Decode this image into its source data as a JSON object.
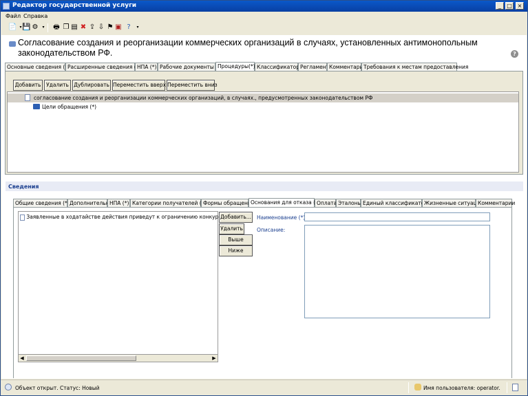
{
  "window": {
    "title": "Редактор государственной услуги",
    "controls": {
      "minimize": "_",
      "maximize": "□",
      "close": "×"
    }
  },
  "menu": {
    "items": [
      "Файл",
      "Справка"
    ]
  },
  "toolbar": {
    "icons": [
      "new-document-icon",
      "save-icon",
      "settings-icon",
      "print-icon",
      "copy-icon",
      "delete-icon",
      "export-icon",
      "import-icon",
      "pdf-icon",
      "help-icon"
    ]
  },
  "header": {
    "title": "Согласование создания и реорганизации коммерческих организаций в случаях, установленных антимонопольным законодательством РФ.",
    "help_glyph": "?"
  },
  "main_tabs": {
    "items": [
      "Основные сведения (*)",
      "Расширенные сведения (*)",
      "НПА (*)",
      "Рабочие документы (*)",
      "Процедуры(*)",
      "Классификаторы",
      "Регламент",
      "Комментарии",
      "Требования к местам предоставления"
    ],
    "active_index": 4
  },
  "procedures": {
    "buttons": {
      "add": "Добавить",
      "delete": "Удалить",
      "duplicate": "Дублировать",
      "move_up": "Переместить вверх",
      "move_down": "Переместить вниз"
    },
    "tree": {
      "root": "согласование создания и реорганизации коммерческих организаций, в случаях., предусмотренных законодательством РФ",
      "child": "Цели обращения (*)"
    }
  },
  "details": {
    "section_label": "Сведения",
    "tabs": {
      "items": [
        "Общие сведения (*)",
        "Дополнительно",
        "НПА (*)",
        "Категории получателей (*)",
        "Формы обращения",
        "Основания для отказа (*)",
        "Оплата",
        "Эталоны",
        "Единый классификатор",
        "Жизненные ситуации",
        "Комментарии"
      ],
      "active_index": 5
    },
    "list": {
      "items": [
        "Заявленные в ходатайстве действия приведут к ограничению конкуренции."
      ]
    },
    "buttons": {
      "add": "Добавить...",
      "delete": "Удалить",
      "up": "Выше",
      "down": "Ниже"
    },
    "form": {
      "name_label": "Наименование (*):",
      "name_value": "",
      "description_label": "Описание:",
      "description_value": ""
    }
  },
  "status": {
    "left": "Объект открыт. Статус: Новый",
    "user": "Имя пользователя: operator."
  }
}
